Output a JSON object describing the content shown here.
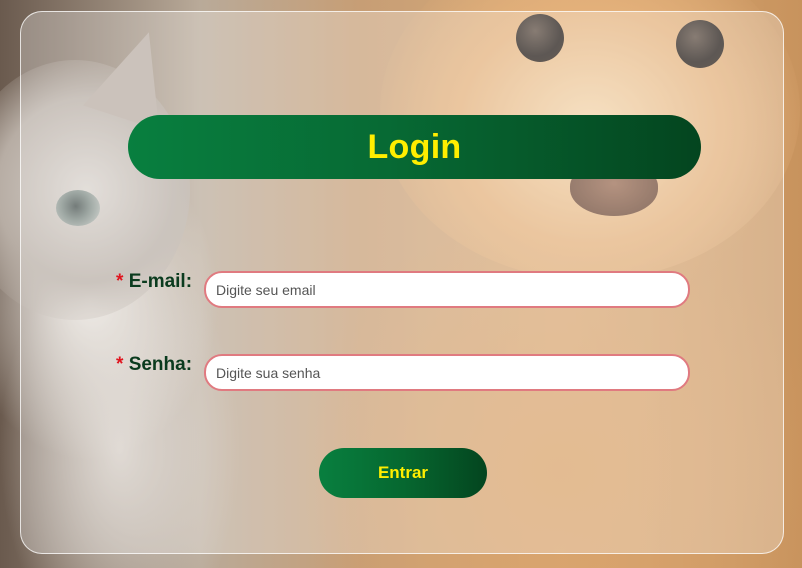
{
  "login": {
    "title": "Login",
    "email": {
      "required_marker": "*",
      "label": "E-mail:",
      "placeholder": "Digite seu email",
      "value": ""
    },
    "password": {
      "required_marker": "*",
      "label": "Senha:",
      "placeholder": "Digite sua senha",
      "value": ""
    },
    "submit_label": "Entrar"
  },
  "colors": {
    "primary_green": "#076a34",
    "accent_yellow": "#ffee00",
    "required_red": "#e0141e",
    "input_border": "#e07a80"
  },
  "background_image": "kitten-and-golden-retriever-puppy-photo"
}
